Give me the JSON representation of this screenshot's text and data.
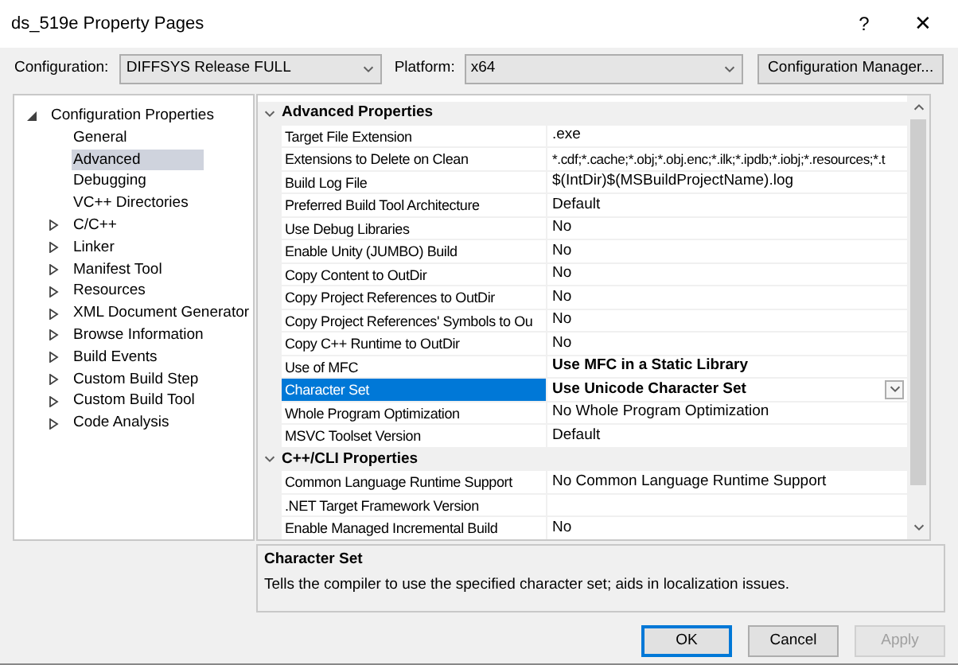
{
  "window": {
    "title": "ds_519e Property Pages",
    "help": "?",
    "close": "✕"
  },
  "toolbar": {
    "configuration_label": "Configuration:",
    "configuration_value": "DIFFSYS Release FULL",
    "platform_label": "Platform:",
    "platform_value": "x64",
    "manager_button": "Configuration Manager..."
  },
  "tree": [
    {
      "label": "Configuration Properties",
      "expanded": true,
      "selected": false,
      "children": [
        {
          "label": "General",
          "selected": false
        },
        {
          "label": "Advanced",
          "selected": true
        },
        {
          "label": "Debugging",
          "selected": false
        },
        {
          "label": "VC++ Directories",
          "selected": false
        },
        {
          "label": "C/C++",
          "selected": false,
          "expanded": false
        },
        {
          "label": "Linker",
          "selected": false,
          "expanded": false
        },
        {
          "label": "Manifest Tool",
          "selected": false,
          "expanded": false
        },
        {
          "label": "Resources",
          "selected": false,
          "expanded": false
        },
        {
          "label": "XML Document Generator",
          "selected": false,
          "expanded": false
        },
        {
          "label": "Browse Information",
          "selected": false,
          "expanded": false
        },
        {
          "label": "Build Events",
          "selected": false,
          "expanded": false
        },
        {
          "label": "Custom Build Step",
          "selected": false,
          "expanded": false
        },
        {
          "label": "Custom Build Tool",
          "selected": false,
          "expanded": false
        },
        {
          "label": "Code Analysis",
          "selected": false,
          "expanded": false
        }
      ]
    }
  ],
  "grid": [
    {
      "title": "Advanced Properties",
      "expanded": true,
      "rows": [
        {
          "name": "Target File Extension",
          "value": ".exe",
          "customized": false,
          "selected": false
        },
        {
          "name": "Extensions to Delete on Clean",
          "value": "*.cdf;*.cache;*.obj;*.obj.enc;*.ilk;*.ipdb;*.iobj;*.resources;*.t",
          "customized": false,
          "selected": false
        },
        {
          "name": "Build Log File",
          "value": "$(IntDir)$(MSBuildProjectName).log",
          "customized": false,
          "selected": false
        },
        {
          "name": "Preferred Build Tool Architecture",
          "value": "Default",
          "customized": false,
          "selected": false
        },
        {
          "name": "Use Debug Libraries",
          "value": "No",
          "customized": false,
          "selected": false
        },
        {
          "name": "Enable Unity (JUMBO) Build",
          "value": "No",
          "customized": false,
          "selected": false
        },
        {
          "name": "Copy Content to OutDir",
          "value": "No",
          "customized": false,
          "selected": false
        },
        {
          "name": "Copy Project References to OutDir",
          "value": "No",
          "customized": false,
          "selected": false
        },
        {
          "name": "Copy Project References' Symbols to Ou",
          "value": "No",
          "customized": false,
          "selected": false
        },
        {
          "name": "Copy C++ Runtime to OutDir",
          "value": "No",
          "customized": false,
          "selected": false
        },
        {
          "name": "Use of MFC",
          "value": "Use MFC in a Static Library",
          "customized": true,
          "selected": false
        },
        {
          "name": "Character Set",
          "value": "Use Unicode Character Set",
          "customized": true,
          "selected": true
        },
        {
          "name": "Whole Program Optimization",
          "value": "No Whole Program Optimization",
          "customized": false,
          "selected": false
        },
        {
          "name": "MSVC Toolset Version",
          "value": "Default",
          "customized": false,
          "selected": false
        }
      ]
    },
    {
      "title": "C++/CLI Properties",
      "expanded": true,
      "rows": [
        {
          "name": "Common Language Runtime Support",
          "value": "No Common Language Runtime Support",
          "customized": false,
          "selected": false
        },
        {
          "name": ".NET Target Framework Version",
          "customized": false,
          "selected": false
        },
        {
          "name": "Enable Managed Incremental Build",
          "value": "No",
          "customized": false,
          "selected": false
        }
      ]
    }
  ],
  "description": {
    "title": "Character Set",
    "text": "Tells the compiler to use the specified character set; aids in localization issues."
  },
  "buttons": [
    {
      "label": "OK",
      "kind": "default",
      "disabled": false
    },
    {
      "label": "Cancel",
      "kind": "normal",
      "disabled": false
    },
    {
      "label": "Apply",
      "kind": "normal",
      "disabled": true
    }
  ]
}
